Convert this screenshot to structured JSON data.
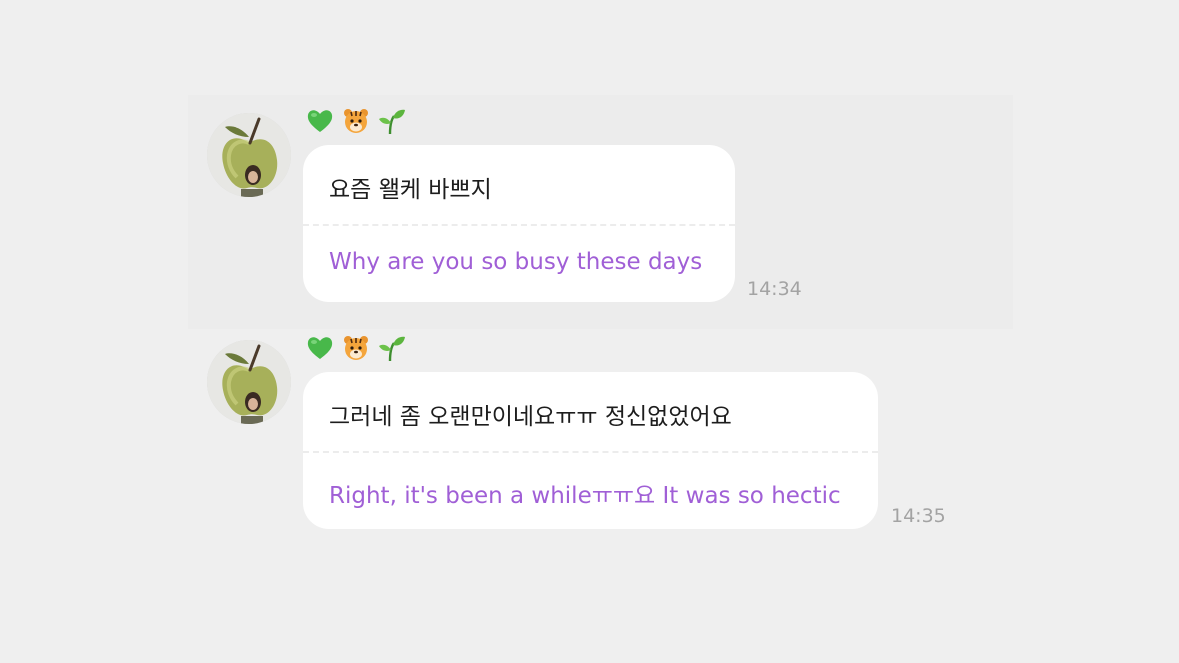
{
  "messages": [
    {
      "sender_emojis": [
        "green-heart",
        "tiger-face",
        "seedling"
      ],
      "original": "요즘 왤케 바쁘지",
      "translation": "Why are you so busy these days",
      "time": "14:34"
    },
    {
      "sender_emojis": [
        "green-heart",
        "tiger-face",
        "seedling"
      ],
      "original": "그러네 좀 오랜만이네요ㅠㅠ 정신없었어요",
      "translation": "Right, it's been a whileㅠㅠ요 It was so hectic",
      "time": "14:35"
    }
  ],
  "colors": {
    "background": "#efefef",
    "bubble": "#ffffff",
    "translation_text": "#a05fd6",
    "timestamp": "#a3a3a3"
  }
}
